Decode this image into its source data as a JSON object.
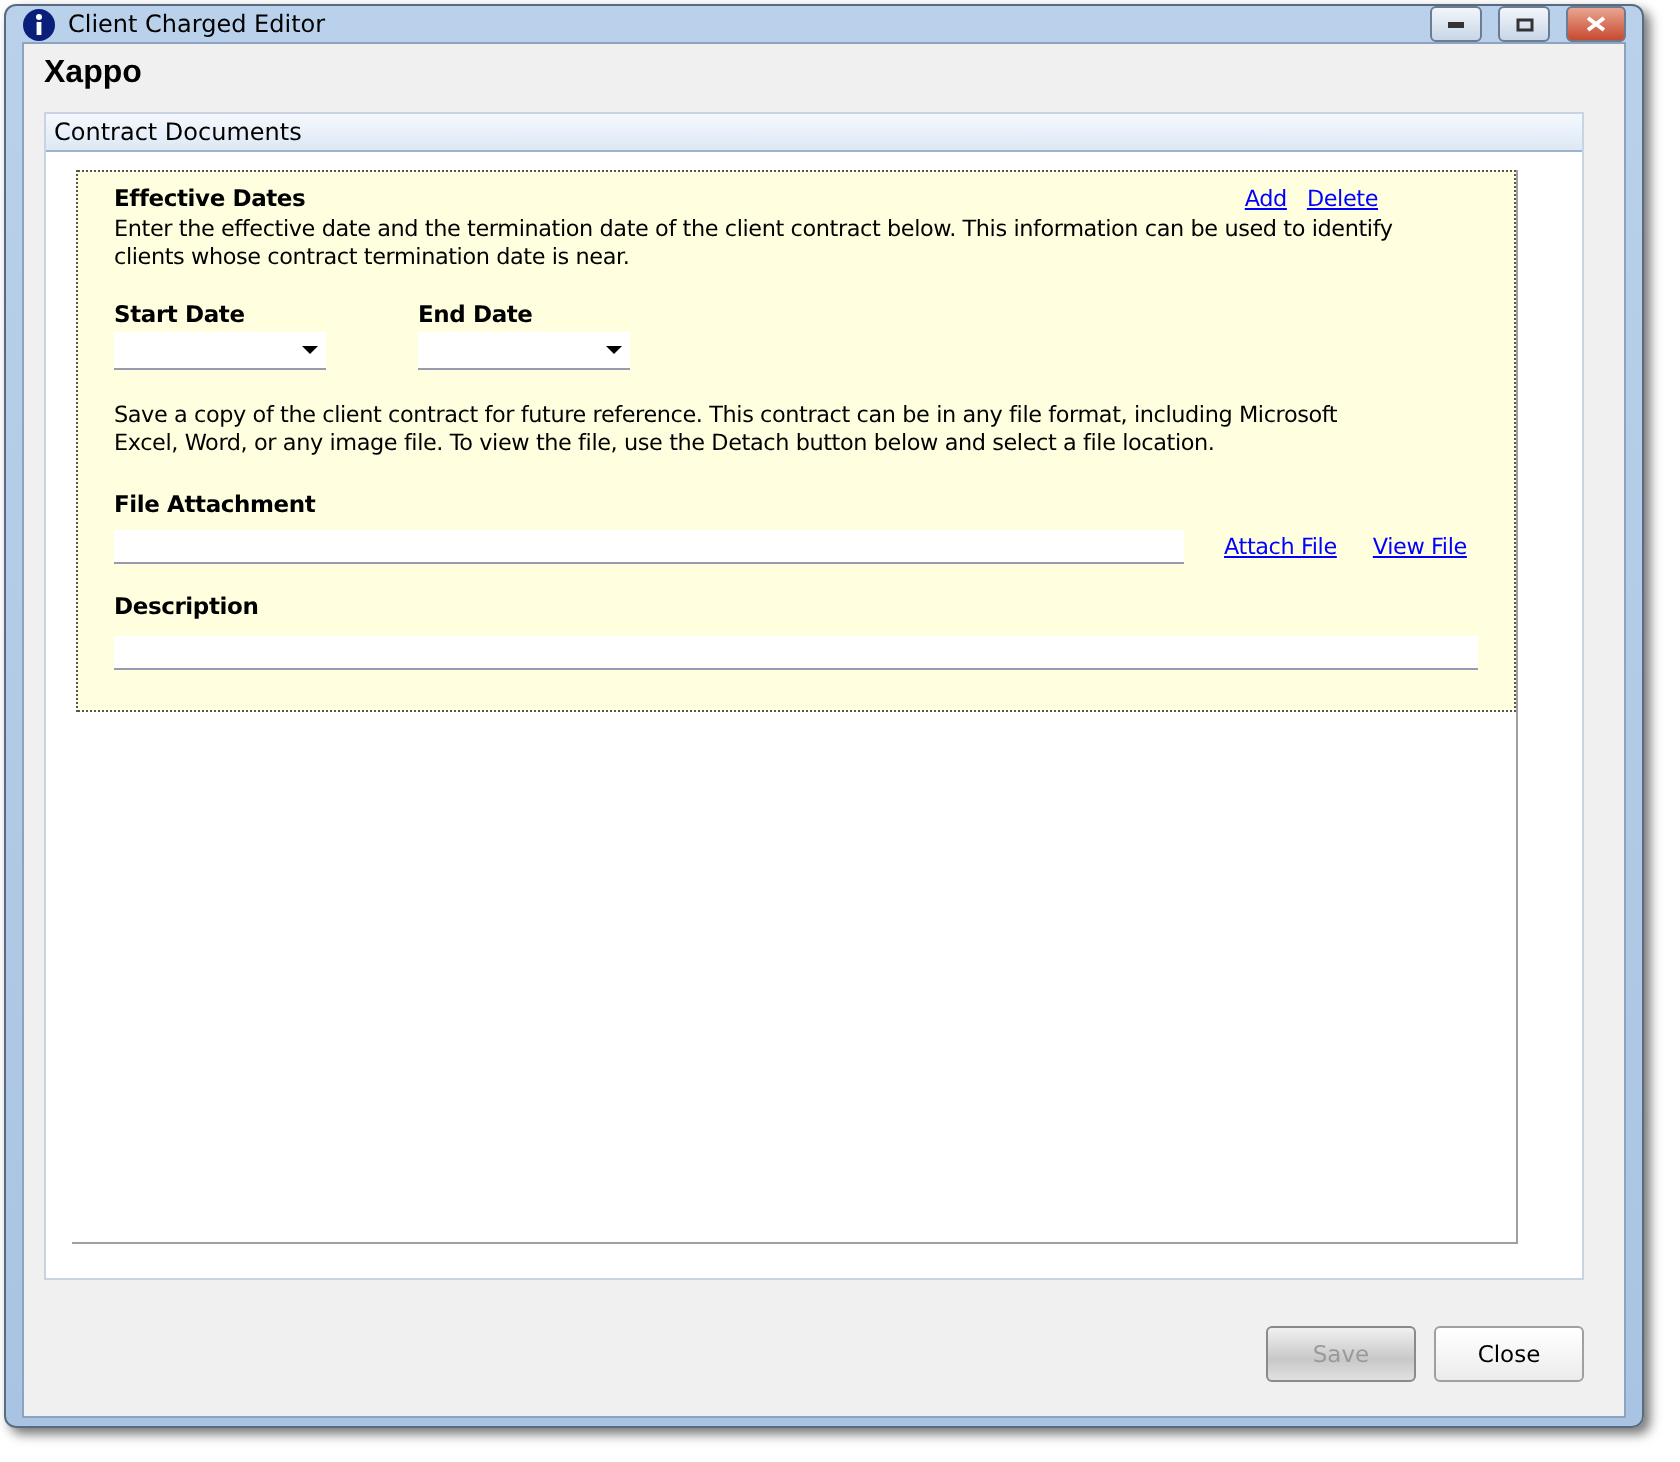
{
  "window": {
    "title": "Client Charged Editor"
  },
  "heading": "Xappo",
  "section": {
    "title": "Contract Documents"
  },
  "card": {
    "title": "Effective Dates",
    "links": [
      "Add",
      "Delete"
    ],
    "intro": "Enter the effective date and the termination date of the client contract below.  This information can be used to identify clients whose contract termination date is near.",
    "start_date": {
      "label": "Start Date"
    },
    "end_date": {
      "label": "End Date"
    },
    "attach_note": "Save a copy of the client contract for future reference.  This contract can be in any file format, including Microsoft Excel, Word, or any image file.  To view the file, use the Detach button below and select a file location.",
    "file_attachment": {
      "label": "File Attachment",
      "links": [
        "Attach File",
        "View File"
      ]
    },
    "description": {
      "label": "Description"
    }
  },
  "buttons": [
    {
      "label": "Save",
      "disabled": true
    },
    {
      "label": "Close",
      "disabled": false
    }
  ]
}
